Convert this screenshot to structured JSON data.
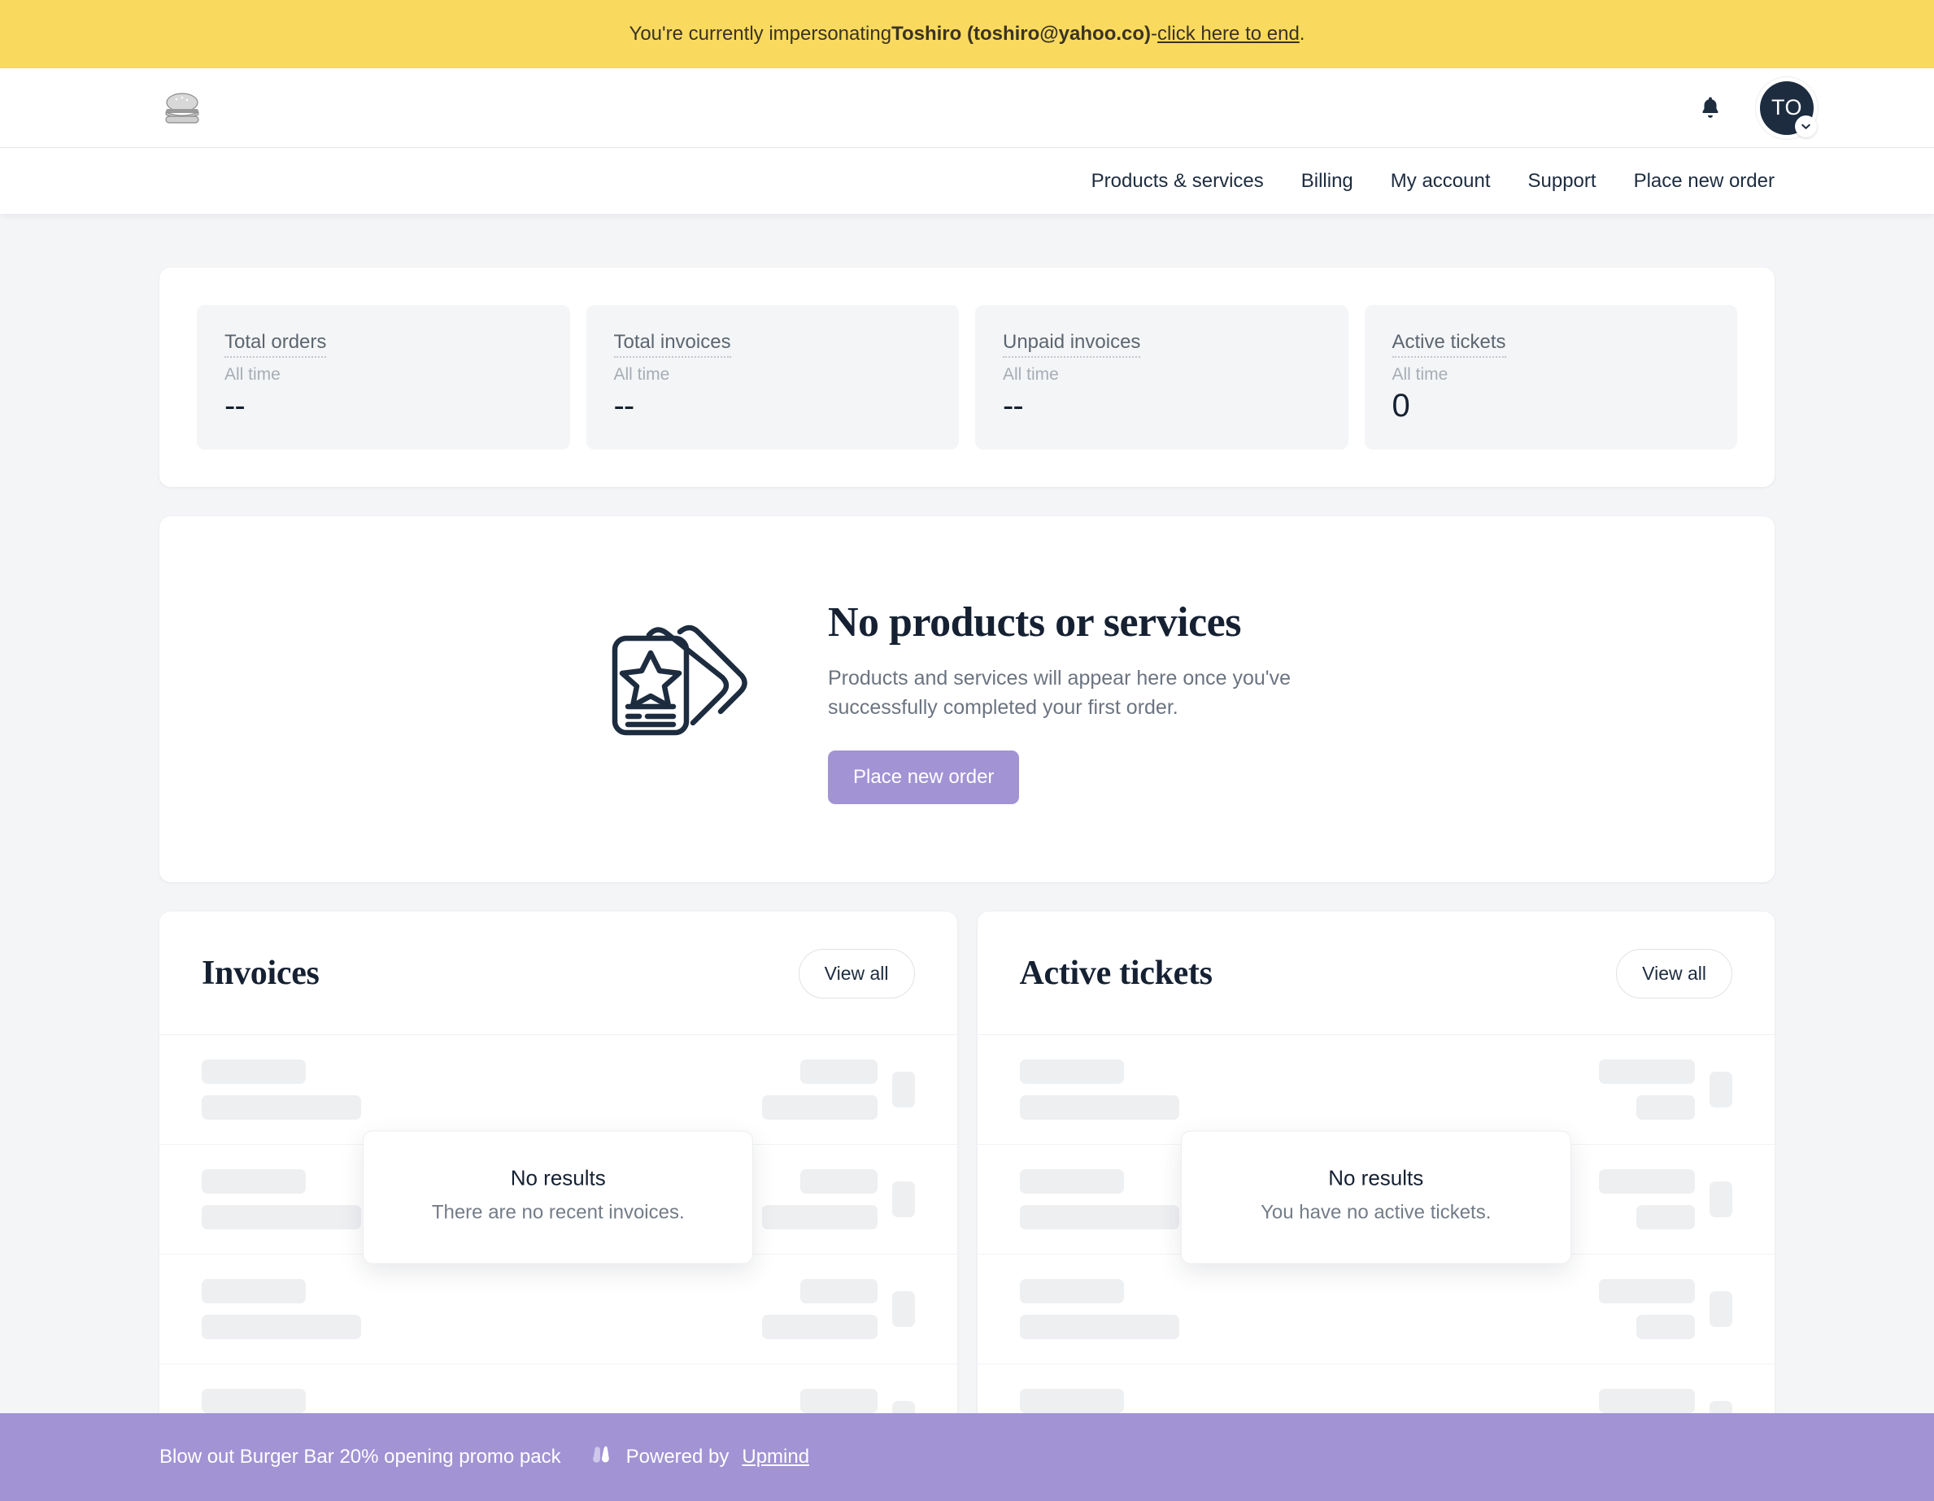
{
  "impersonation": {
    "prefix": "You're currently impersonating ",
    "user": "Toshiro (toshiro@yahoo.co)",
    "separator": " - ",
    "link": "click here to end",
    "suffix": "."
  },
  "header": {
    "logo_icon": "burger-logo",
    "notifications_icon": "bell-icon",
    "avatar_initials": "TO",
    "avatar_caret_icon": "chevron-down-icon"
  },
  "nav": {
    "items": [
      {
        "label": "Products & services"
      },
      {
        "label": "Billing"
      },
      {
        "label": "My account"
      },
      {
        "label": "Support"
      },
      {
        "label": "Place new order"
      }
    ]
  },
  "stats": [
    {
      "title": "Total orders",
      "sub": "All time",
      "value": "--"
    },
    {
      "title": "Total invoices",
      "sub": "All time",
      "value": "--"
    },
    {
      "title": "Unpaid invoices",
      "sub": "All time",
      "value": "--"
    },
    {
      "title": "Active tickets",
      "sub": "All time",
      "value": "0"
    }
  ],
  "empty_state": {
    "illustration_icon": "stacked-cards-star-icon",
    "title": "No products or services",
    "text": "Products and services will appear here once you've successfully completed your first order.",
    "button": "Place new order"
  },
  "panels": {
    "invoices": {
      "title": "Invoices",
      "view_all": "View all",
      "no_results_title": "No results",
      "no_results_text": "There are no recent invoices."
    },
    "tickets": {
      "title": "Active tickets",
      "view_all": "View all",
      "no_results_title": "No results",
      "no_results_text": "You have no active tickets."
    }
  },
  "footer": {
    "promo": "Blow out Burger Bar 20% opening promo pack",
    "logo_icon": "upmind-logo-icon",
    "powered_by": "Powered by ",
    "brand": "Upmind"
  },
  "colors": {
    "banner_bg": "#fada5e",
    "accent_purple": "#a193d4",
    "dark_navy": "#1d2c3f",
    "page_bg": "#f4f5f7"
  }
}
